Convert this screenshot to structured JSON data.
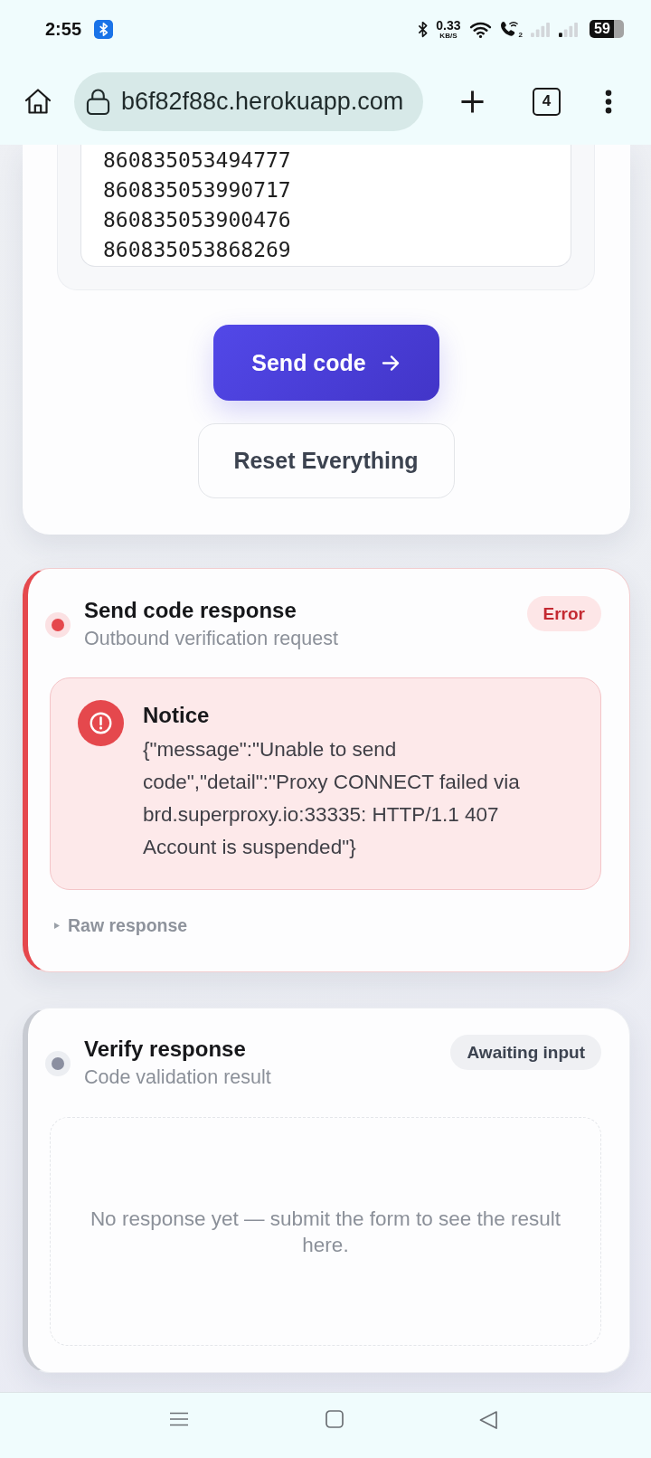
{
  "status_bar": {
    "time": "2:55",
    "net_speed": "0.33",
    "net_speed_unit": "KB/S",
    "sim_label": "2",
    "battery": "59"
  },
  "browser_bar": {
    "url": "b6f82f88c.herokuapp.com",
    "tab_count": "4"
  },
  "form": {
    "codes_field": {
      "value": "860835053494777\n860835053990717\n860835053900476\n860835053868269"
    },
    "buttons": [
      {
        "label": "Send code",
        "kind": "primary"
      },
      {
        "label": "Reset Everything",
        "kind": "secondary"
      }
    ]
  },
  "responses": [
    {
      "kind": "error",
      "title": "Send code response",
      "subtitle": "Outbound verification request",
      "badge": "Error",
      "notice": {
        "title": "Notice",
        "message": "{\"message\":\"Unable to send code\",\"detail\":\"Proxy CONNECT failed via brd.superproxy.io:33335: HTTP/1.1 407 Account is suspended\"}"
      },
      "raw_response": {
        "label": "Raw response",
        "expanded": false
      }
    },
    {
      "kind": "waiting",
      "title": "Verify response",
      "subtitle": "Code validation result",
      "badge": "Awaiting input",
      "empty_message": "No response yet — submit the form to see the result here."
    }
  ]
}
